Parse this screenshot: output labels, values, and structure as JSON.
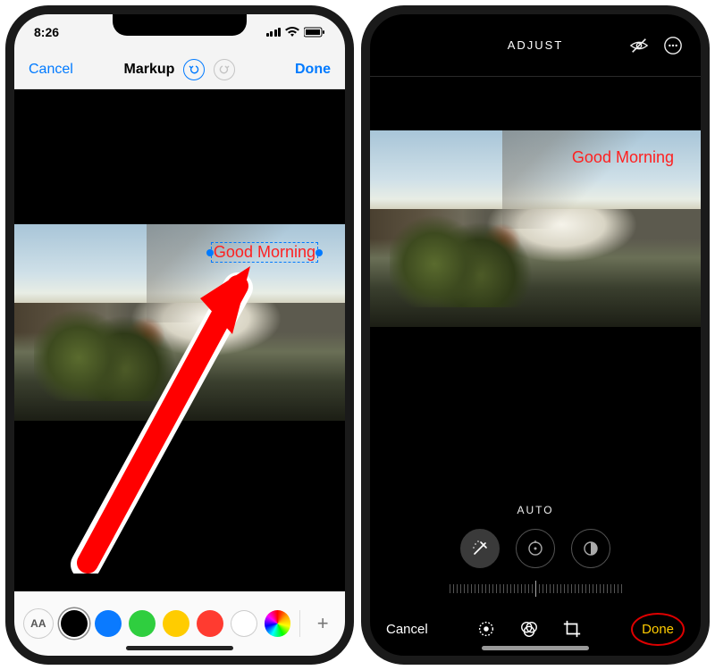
{
  "left": {
    "status": {
      "time": "8:26"
    },
    "nav": {
      "cancel": "Cancel",
      "title": "Markup",
      "done": "Done"
    },
    "overlay_text": "Good Morning",
    "toolbar": {
      "text_style_label": "AA",
      "colors": [
        {
          "name": "black",
          "hex": "#000000",
          "selected": true
        },
        {
          "name": "blue",
          "hex": "#0a7aff",
          "selected": false
        },
        {
          "name": "green",
          "hex": "#2fce3f",
          "selected": false
        },
        {
          "name": "yellow",
          "hex": "#ffcc00",
          "selected": false
        },
        {
          "name": "red",
          "hex": "#ff3b30",
          "selected": false
        },
        {
          "name": "white",
          "hex": "#ffffff",
          "selected": false
        }
      ],
      "plus": "+"
    }
  },
  "right": {
    "header": {
      "title": "ADJUST"
    },
    "overlay_text": "Good Morning",
    "auto_label": "AUTO",
    "bottom": {
      "cancel": "Cancel",
      "done": "Done"
    }
  }
}
